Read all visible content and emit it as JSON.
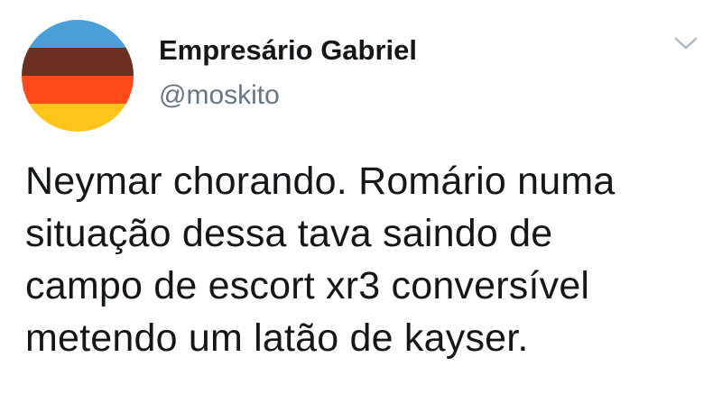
{
  "author": {
    "display_name": "Empresário Gabriel",
    "handle": "@moskito",
    "avatar_icon": "striped-flag-avatar",
    "avatar_colors": [
      "#4a9fd8",
      "#6b2f20",
      "#ff4a1c",
      "#ffc41c"
    ]
  },
  "controls": {
    "more_icon": "chevron-down-icon"
  },
  "tweet": {
    "lines": [
      "Neymar chorando. Romário numa",
      "situação dessa tava saindo de",
      "campo de escort xr3 conversível",
      "metendo um latão de kayser."
    ]
  }
}
